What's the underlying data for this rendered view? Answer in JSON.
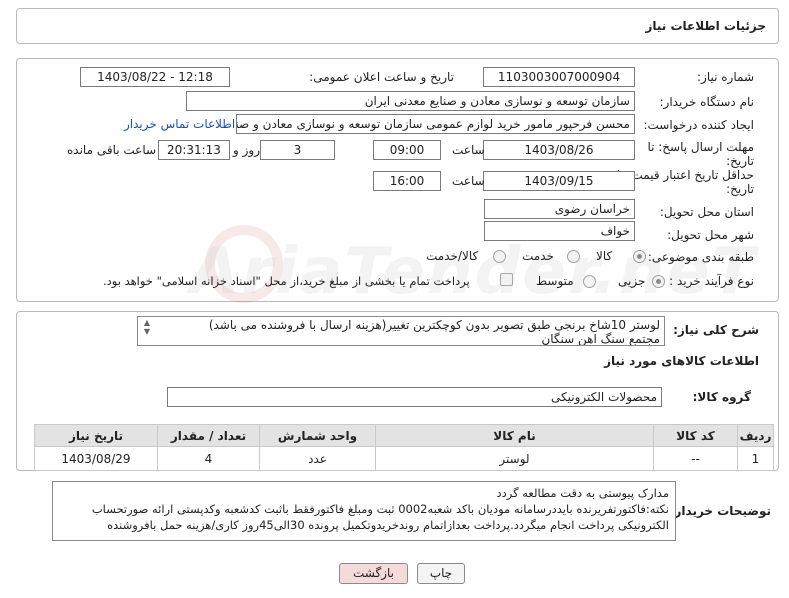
{
  "header": {
    "title": "جزئیات اطلاعات نیاز"
  },
  "form": {
    "need_number_label": "شماره نیاز:",
    "need_number": "1103003007000904",
    "announce_label": "تاریخ و ساعت اعلان عمومی:",
    "announce_value": "1403/08/22 - 12:18",
    "buyer_label": "نام دستگاه خریدار:",
    "buyer_value": "سازمان توسعه و نوسازی معادن و صنایع معدنی ایران",
    "creator_label": "ایجاد کننده درخواست:",
    "creator_value": "محسن فرحپور مامور خرید لوازم عمومی سازمان توسعه و نوسازی معادن و صنایع",
    "contact_link": "اطلاعات تماس خریدار",
    "deadline_label": "مهلت ارسال پاسخ: تا",
    "deadline_label2": "تاریخ:",
    "deadline_date": "1403/08/26",
    "time_word": "ساعت",
    "deadline_time": "09:00",
    "days_value": "3",
    "days_word": "روز و",
    "remaining_time": "20:31:13",
    "remaining_word": "ساعت باقی مانده",
    "validity_label": "حداقل تاریخ اعتبار قیمت: تا",
    "validity_label2": "تاریخ:",
    "validity_date": "1403/09/15",
    "validity_time": "16:00",
    "province_label": "استان محل تحویل:",
    "province_value": "خراسان رضوی",
    "city_label": "شهر محل تحویل:",
    "city_value": "خواف",
    "category_label": "طبقه بندی موضوعی:",
    "category_options": [
      "کالا",
      "خدمت",
      "کالا/خدمت"
    ],
    "category_selected": "کالا",
    "process_label": "نوع فرآیند خرید :",
    "process_options": [
      "جزیی",
      "متوسط"
    ],
    "process_selected": "جزیی",
    "payment_note": "پرداخت تمام یا بخشی از مبلغ خرید،از محل \"اسناد خزانه اسلامی\" خواهد بود."
  },
  "description": {
    "label": "شرح کلی نیاز:",
    "text_line1": "لوستر 10شاخ برنجی طبق تصویر بدون کوچکترین تغییر(هزینه ارسال با فروشنده می باشد)",
    "text_line2": "مجتمع سنگ اهن سنگان"
  },
  "goods": {
    "section_title": "اطلاعات کالاهای مورد نیاز",
    "group_label": "گروه کالا:",
    "group_value": "محصولات الکترونیکی",
    "columns": [
      "ردیف",
      "کد کالا",
      "نام کالا",
      "واحد شمارش",
      "تعداد / مقدار",
      "تاریخ نیاز"
    ],
    "rows": [
      {
        "row": "1",
        "code": "--",
        "name": "لوستر",
        "unit": "عدد",
        "qty": "4",
        "date": "1403/08/29"
      }
    ]
  },
  "buyer_notes": {
    "label": "توضیحات خریدار:",
    "line1": "مدارک پیوستی به دقت مطالعه گردد",
    "line2": "نکته:فاکتورتفریرنده بایددرسامانه مودیان باکد شعبه0002 ثبت ومبلغ فاکتورفقط باثبت کدشعبه وکدپستی ارائه صورتحساب",
    "line3": "الکترونیکی پرداخت انجام میگردد.پرداخت بعدازاتمام روندخریدوتکمیل پرونده 30الی45روز کاری/هزینه حمل بافروشنده"
  },
  "buttons": {
    "print": "چاپ",
    "back": "بازگشت"
  },
  "watermark": "AriaTender.neT",
  "colors": {
    "link": "#1a4fb5",
    "back_button_bg": "#f6dada",
    "header_bg": "#ffffff"
  }
}
